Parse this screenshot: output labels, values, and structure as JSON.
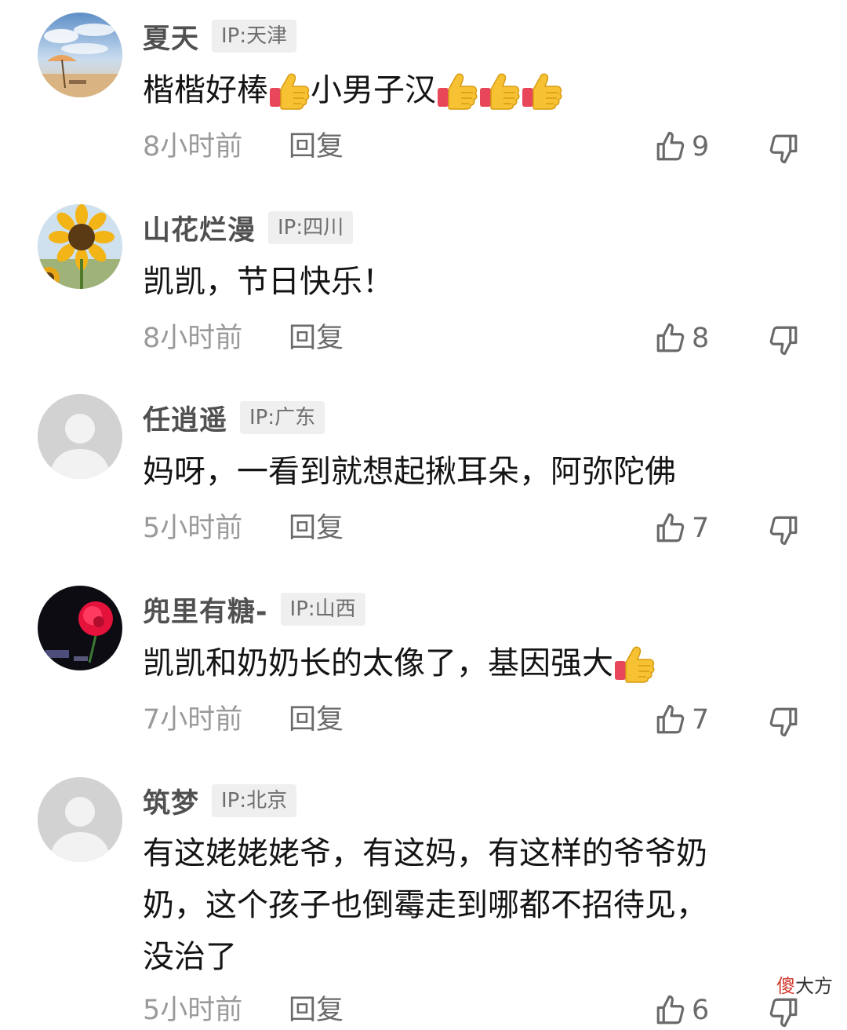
{
  "comments": [
    {
      "username": "夏天",
      "ip": "IP:天津",
      "text_before": "楷楷好棒",
      "text_after": "小男子汉",
      "time": "8小时前",
      "reply": "回复",
      "likes": "9",
      "avatar": "beach-umbrella-sky"
    },
    {
      "username": "山花烂漫",
      "ip": "IP:四川",
      "text": "凯凯，节日快乐！",
      "time": "8小时前",
      "reply": "回复",
      "likes": "8",
      "avatar": "sunflower"
    },
    {
      "username": "任逍遥",
      "ip": "IP:广东",
      "text": "妈呀，一看到就想起揪耳朵，阿弥陀佛",
      "time": "5小时前",
      "reply": "回复",
      "likes": "7",
      "avatar": "default-user"
    },
    {
      "username": "兜里有糖-",
      "ip": "IP:山西",
      "text": "凯凯和奶奶长的太像了，基因强大",
      "time": "7小时前",
      "reply": "回复",
      "likes": "7",
      "avatar": "red-rose-night"
    },
    {
      "username": "筑梦",
      "ip": "IP:北京",
      "text_lines": [
        "有这姥姥姥爷，有这妈，有这样的爷爷奶",
        "奶，这个孩子也倒霉走到哪都不招待见，",
        "没治了"
      ],
      "time": "5小时前",
      "reply": "回复",
      "likes": "6",
      "avatar": "default-user"
    }
  ],
  "watermark": {
    "part1": "傻",
    "part2": "大方"
  },
  "icons": {
    "like": "thumbs-up-outline-icon",
    "dislike": "thumbs-down-outline-icon",
    "emoji": "thumbs-up-emoji-icon"
  },
  "colors": {
    "username": "#505050",
    "badge_bg": "#efefef",
    "meta": "#9a9a9a",
    "text": "#141414"
  }
}
